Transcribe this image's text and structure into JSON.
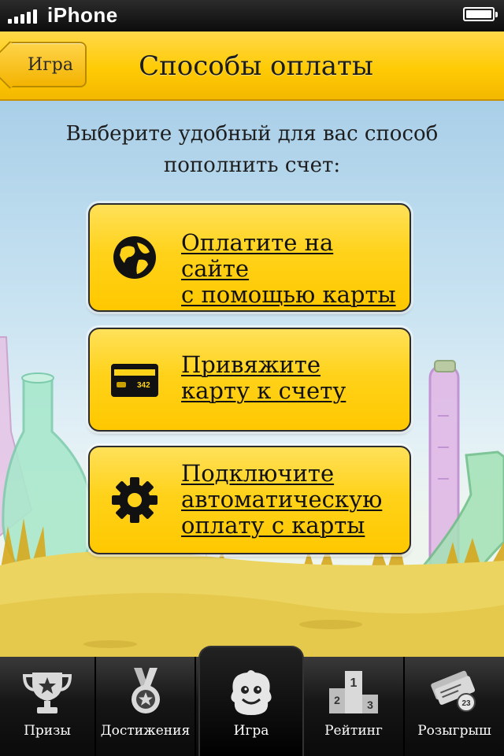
{
  "status_bar": {
    "carrier": "iPhone",
    "signal_bars": 5,
    "battery_level": 1.0
  },
  "nav": {
    "back_label": "Игра",
    "title": "Способы оплаты"
  },
  "intro": {
    "line1": "Выберите удобный для вас способ",
    "line2": "пополнить счет:"
  },
  "options": [
    {
      "icon": "globe-icon",
      "lines": [
        "Оплатите на сайте",
        "с помощью карты"
      ]
    },
    {
      "icon": "credit-card-icon",
      "card_number": "342",
      "lines": [
        "Привяжите",
        "карту к счету"
      ]
    },
    {
      "icon": "gear-icon",
      "lines": [
        "Подключите",
        "автоматическую",
        "оплату с карты"
      ]
    }
  ],
  "tabs": [
    {
      "label": "Призы",
      "icon": "trophy-icon",
      "active": false
    },
    {
      "label": "Достижения",
      "icon": "medal-icon",
      "active": false
    },
    {
      "label": "Игра",
      "icon": "monster-icon",
      "active": true
    },
    {
      "label": "Рейтинг",
      "icon": "podium-icon",
      "active": false,
      "podium": [
        "1",
        "2",
        "3"
      ]
    },
    {
      "label": "Розыгрыш",
      "icon": "tickets-icon",
      "active": false,
      "ticket_number": "23"
    }
  ],
  "colors": {
    "accent": "#ffcb05",
    "button_border": "#2c2c2c",
    "sky": "#c7e2f1",
    "ground": "#e9cf55"
  }
}
